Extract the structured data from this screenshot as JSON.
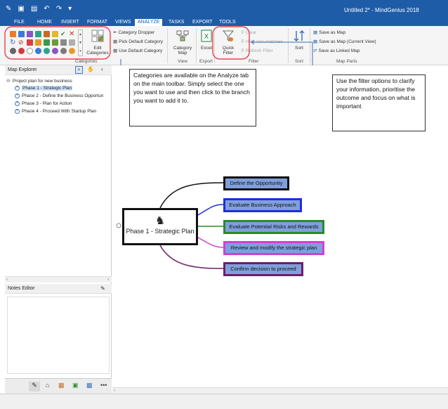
{
  "window": {
    "title": "Untitled 2* - MindGenius 2018"
  },
  "tabs": [
    {
      "label": "FILE"
    },
    {
      "label": "HOME"
    },
    {
      "label": "INSERT"
    },
    {
      "label": "FORMAT"
    },
    {
      "label": "VIEWS"
    },
    {
      "label": "ANALYZE"
    },
    {
      "label": "TASKS"
    },
    {
      "label": "EXPORT"
    },
    {
      "label": "TOOLS"
    }
  ],
  "ribbon": {
    "categories_group": "Categories",
    "edit_categories": "Edit Categories",
    "category_dropper": "Category Dropper",
    "pick_default_category": "Pick Default Category",
    "use_default_category": "Use Default Category",
    "category_map": "Category Map",
    "view_group": "View",
    "excel": "Excel",
    "export_group": "Export",
    "quick_filter": "Quick Filter",
    "clear": "Clear",
    "hide_non_matches": "Hide non-matches",
    "refresh_filter": "Refresh Filter",
    "filter_group": "Filter",
    "sort": "Sort",
    "sort_group": "Sort",
    "save_as_map": "Save as Map",
    "save_as_map_current_view": "Save as Map (Current View)",
    "save_as_linked_map": "Save as Linked Map",
    "map_parts_group": "Map Parts"
  },
  "explorer": {
    "title": "Map Explorer",
    "root": "Project plan for new business",
    "items": [
      {
        "label": "Phase 1 - Strategic Plan"
      },
      {
        "label": "Phase 2 - Define the Business Opportun"
      },
      {
        "label": "Phase 3 - Plan for Action"
      },
      {
        "label": "Phase 4 - Proceed With Startup Plan"
      }
    ]
  },
  "notes": {
    "title": "Notes Editor"
  },
  "callouts": {
    "categories": "Categories are available on the Analyze tab on the main toolbar. Simply select the one you want to use and then click to the branch you want to add it to.",
    "filter": "Use the filter options to clarify your information, prioritise the outcome and focus on what is important"
  },
  "map": {
    "central": "Phase 1 - Strategic Plan",
    "branches": [
      {
        "label": "Define the Opportunity",
        "border": "#111111"
      },
      {
        "label": "Evaluate Business Approach",
        "border": "#1f2fd8"
      },
      {
        "label": "Evaluate Potential Risks and Rewards",
        "border": "#2a8a2a"
      },
      {
        "label": "Review and modify the strategic plan",
        "border": "#d23fd2"
      },
      {
        "label": "Confirm decision to proceed",
        "border": "#6a1f6a"
      }
    ]
  },
  "colors": {
    "titlebar": "#1e5ca8",
    "branch_fill": "#7f9fdc",
    "highlight": "#e8242b"
  },
  "bottom_icons": [
    "pencil-icon",
    "home-icon",
    "grid-icon",
    "tag-icon",
    "image-icon",
    "more-icon"
  ]
}
